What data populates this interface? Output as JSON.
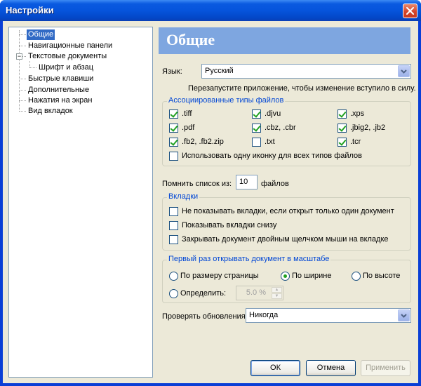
{
  "window": {
    "title": "Настройки"
  },
  "tree": {
    "items": [
      {
        "label": "Общие",
        "selected": true
      },
      {
        "label": "Навигационные панели"
      },
      {
        "label": "Текстовые документы",
        "expander": "−"
      },
      {
        "label": "Шрифт и абзац"
      },
      {
        "label": "Быстрые клавиши"
      },
      {
        "label": "Дополнительные"
      },
      {
        "label": "Нажатия на экран"
      },
      {
        "label": "Вид вкладок"
      }
    ]
  },
  "panel": {
    "header": "Общие",
    "language_label": "Язык:",
    "language_value": "Русский",
    "restart_note": "Перезапустите приложение, чтобы изменение вступило в силу.",
    "filetypes": {
      "title": "Ассоциированные типы файлов",
      "items": [
        {
          "label": ".tiff",
          "checked": true
        },
        {
          "label": ".djvu",
          "checked": true
        },
        {
          "label": ".xps",
          "checked": true
        },
        {
          "label": ".pdf",
          "checked": true
        },
        {
          "label": ".cbz, .cbr",
          "checked": true
        },
        {
          "label": ".jbig2, .jb2",
          "checked": true
        },
        {
          "label": ".fb2, .fb2.zip",
          "checked": true
        },
        {
          "label": ".txt",
          "checked": false
        },
        {
          "label": ".tcr",
          "checked": true
        }
      ],
      "single_icon": {
        "label": "Использовать одну иконку для всех типов файлов",
        "checked": false
      }
    },
    "recent": {
      "label": "Помнить список из:",
      "value": "10",
      "suffix": "файлов"
    },
    "tabs": {
      "title": "Вкладки",
      "options": [
        {
          "label": "Не показывать вкладки, если открыт только один документ",
          "checked": false
        },
        {
          "label": "Показывать вкладки снизу",
          "checked": false
        },
        {
          "label": "Закрывать документ двойным щелчком мыши на вкладке",
          "checked": false
        }
      ]
    },
    "zoom": {
      "title": "Первый раз открывать документ в масштабе",
      "fit_page": "По размеру страницы",
      "fit_width": "По ширине",
      "fit_height": "По высоте",
      "custom": "Определить:",
      "custom_value": "5.0 %",
      "selected": "fit_width"
    },
    "updates": {
      "label": "Проверять обновления:",
      "value": "Никогда"
    }
  },
  "buttons": {
    "ok": "ОК",
    "cancel": "Отмена",
    "apply": "Применить"
  }
}
